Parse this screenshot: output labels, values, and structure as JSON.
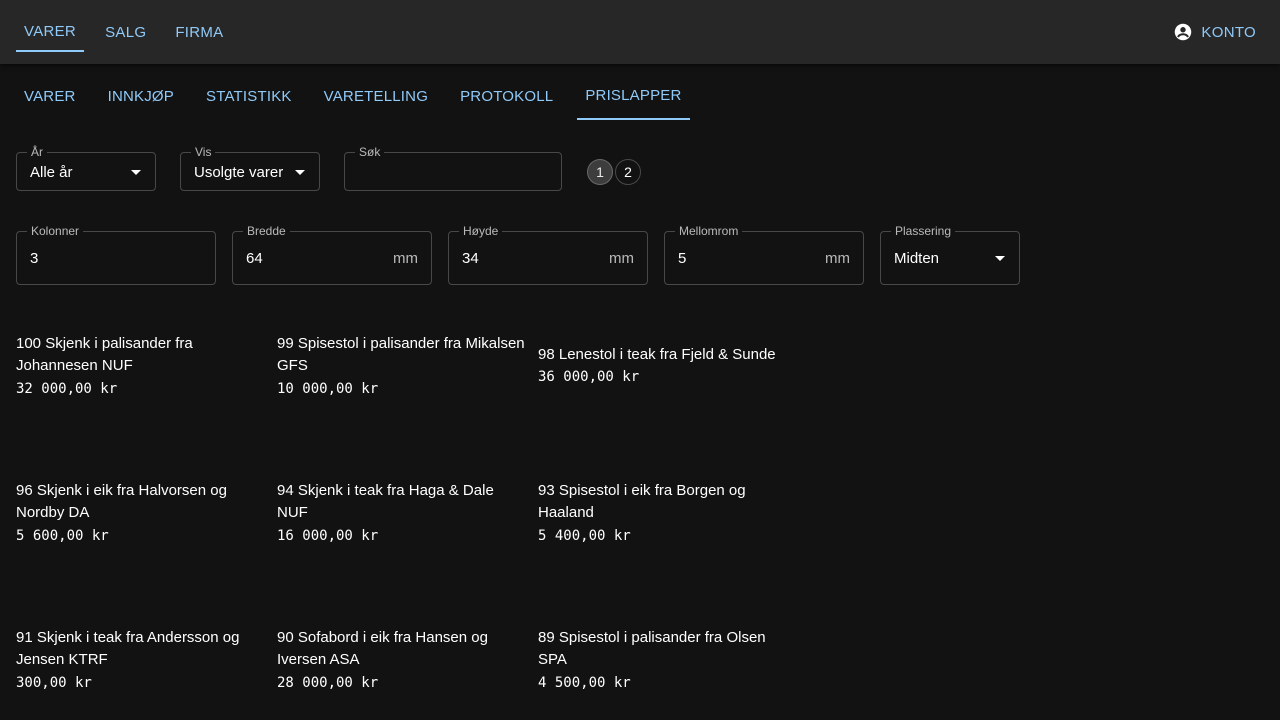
{
  "topnav": {
    "items": [
      {
        "label": "VARER",
        "active": true
      },
      {
        "label": "SALG",
        "active": false
      },
      {
        "label": "FIRMA",
        "active": false
      }
    ],
    "account_label": "KONTO"
  },
  "tabs": [
    {
      "label": "VARER",
      "active": false
    },
    {
      "label": "INNKJØP",
      "active": false
    },
    {
      "label": "STATISTIKK",
      "active": false
    },
    {
      "label": "VARETELLING",
      "active": false
    },
    {
      "label": "PROTOKOLL",
      "active": false
    },
    {
      "label": "PRISLAPPER",
      "active": true
    }
  ],
  "filters": {
    "year": {
      "label": "År",
      "value": "Alle år"
    },
    "show": {
      "label": "Vis",
      "value": "Usolgte varer"
    },
    "search": {
      "label": "Søk",
      "value": ""
    },
    "pages": [
      "1",
      "2"
    ],
    "current_page": "1"
  },
  "layout_settings": {
    "columns": {
      "label": "Kolonner",
      "value": "3"
    },
    "width": {
      "label": "Bredde",
      "value": "64",
      "unit": "mm"
    },
    "height": {
      "label": "Høyde",
      "value": "34",
      "unit": "mm"
    },
    "spacing": {
      "label": "Mellomrom",
      "value": "5",
      "unit": "mm"
    },
    "placement": {
      "label": "Plassering",
      "value": "Midten"
    }
  },
  "labels": [
    {
      "title": "100 Skjenk i palisander fra Johannesen NUF",
      "price": "32 000,00 kr"
    },
    {
      "title": "99 Spisestol i palisander fra Mikalsen GFS",
      "price": "10 000,00 kr"
    },
    {
      "title": "98 Lenestol i teak fra Fjeld & Sunde",
      "price": "36 000,00 kr"
    },
    {
      "title": "96 Skjenk i eik fra Halvorsen og Nordby DA",
      "price": "5 600,00 kr"
    },
    {
      "title": "94 Skjenk i teak fra Haga & Dale NUF",
      "price": "16 000,00 kr"
    },
    {
      "title": "93 Spisestol i eik fra Borgen og Haaland",
      "price": "5 400,00 kr"
    },
    {
      "title": "91 Skjenk i teak fra Andersson og Jensen KTRF",
      "price": "300,00 kr"
    },
    {
      "title": "90 Sofabord i eik fra Hansen og Iversen ASA",
      "price": "28 000,00 kr"
    },
    {
      "title": "89 Spisestol i palisander fra Olsen SPA",
      "price": "4 500,00 kr"
    }
  ]
}
